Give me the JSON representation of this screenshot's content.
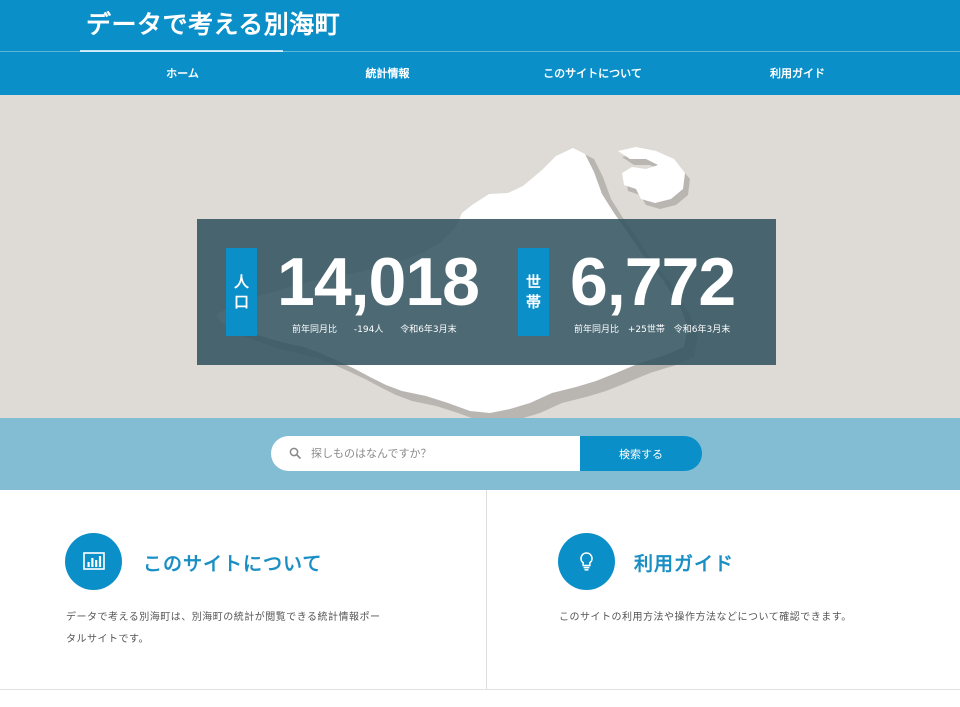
{
  "site": {
    "title": "データで考える別海町"
  },
  "nav": [
    {
      "label": "ホーム"
    },
    {
      "label": "統計情報"
    },
    {
      "label": "このサイトについて"
    },
    {
      "label": "利用ガイド"
    }
  ],
  "hero": {
    "population": {
      "tag_line1": "人",
      "tag_line2": "口",
      "value": "14,018",
      "compare_label": "前年同月比",
      "compare_value": "-194人",
      "as_of": "令和6年3月末"
    },
    "households": {
      "tag_line1": "世",
      "tag_line2": "帯",
      "value": "6,772",
      "compare_label": "前年同月比",
      "compare_value": "+25世帯",
      "as_of": "令和6年3月末"
    }
  },
  "search": {
    "placeholder": "探しものはなんですか？",
    "button_label": "検索する"
  },
  "cards": [
    {
      "icon": "bar-chart-icon",
      "title": "このサイトについて",
      "text_line1": "データで考える別海町は、別海町の統計が閲覧できる統計情報ポー",
      "text_line2": "タルサイトです。"
    },
    {
      "icon": "lightbulb-icon",
      "title": "利用ガイド",
      "text_line1": "このサイトの利用方法や操作方法などについて確認できます。"
    }
  ],
  "colors": {
    "brand": "#0a8fc9",
    "hero_bg": "#dedbd6",
    "panel": "#335461",
    "search_band": "#82bdd3",
    "card_title": "#1a8fc4"
  }
}
